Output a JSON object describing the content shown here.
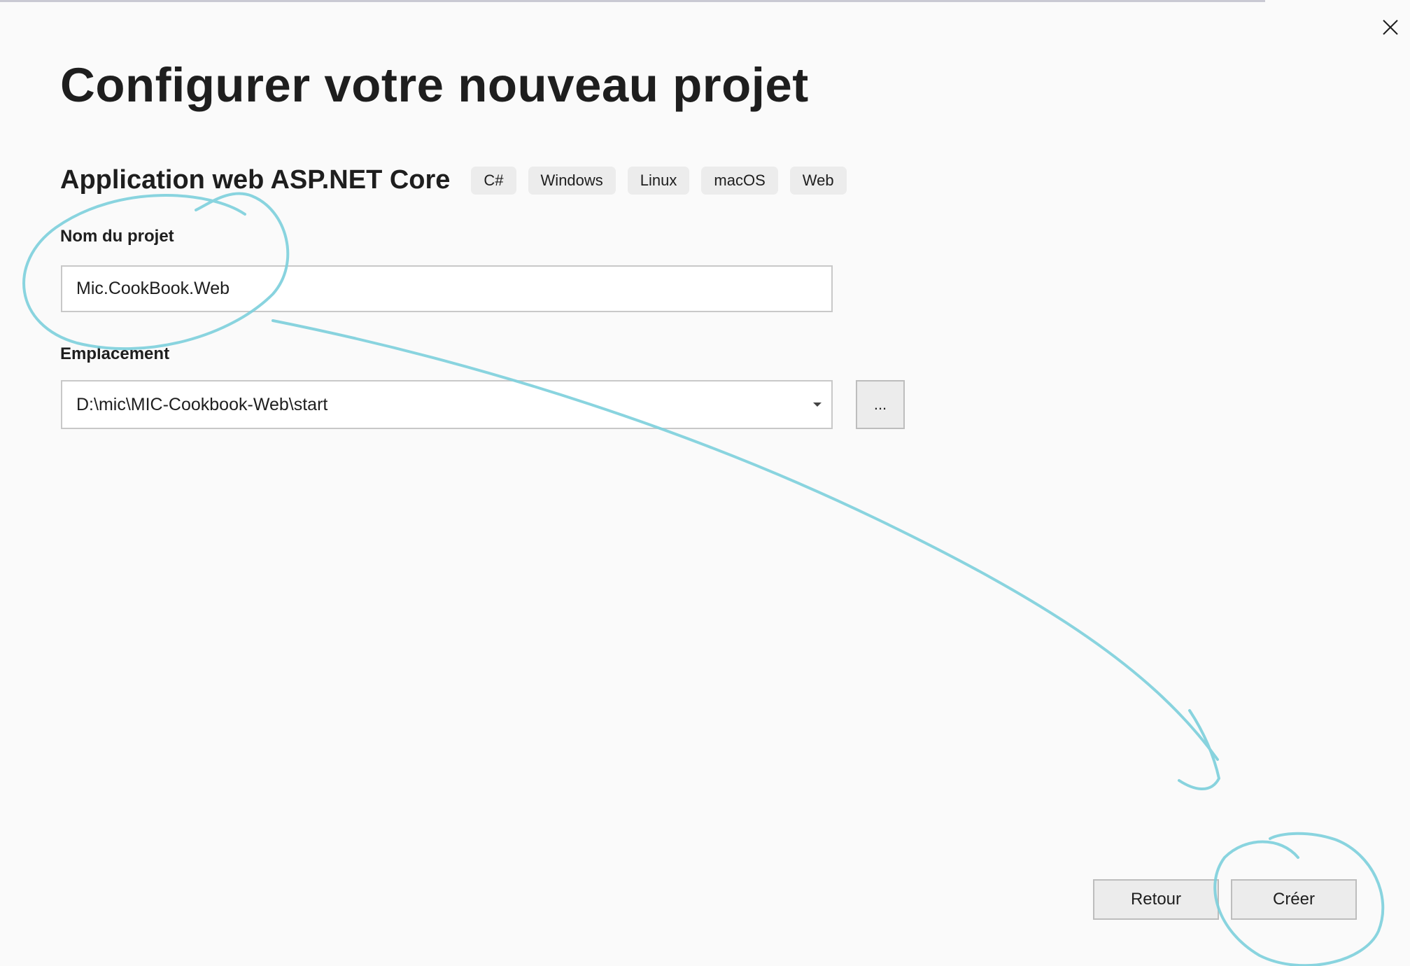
{
  "dialog": {
    "title": "Configurer votre nouveau projet",
    "close_icon": "close-icon"
  },
  "template": {
    "name": "Application web ASP.NET Core",
    "tags": [
      "C#",
      "Windows",
      "Linux",
      "macOS",
      "Web"
    ]
  },
  "form": {
    "project_name_label": "Nom du projet",
    "project_name_value": "Mic.CookBook.Web",
    "location_label": "Emplacement",
    "location_value": "D:\\mic\\MIC-Cookbook-Web\\start",
    "location_dropdown_icon": "chevron-down-icon",
    "browse_label": "..."
  },
  "footer": {
    "back_label": "Retour",
    "create_label": "Créer"
  },
  "annotation": {
    "color": "#7ccfdc"
  }
}
